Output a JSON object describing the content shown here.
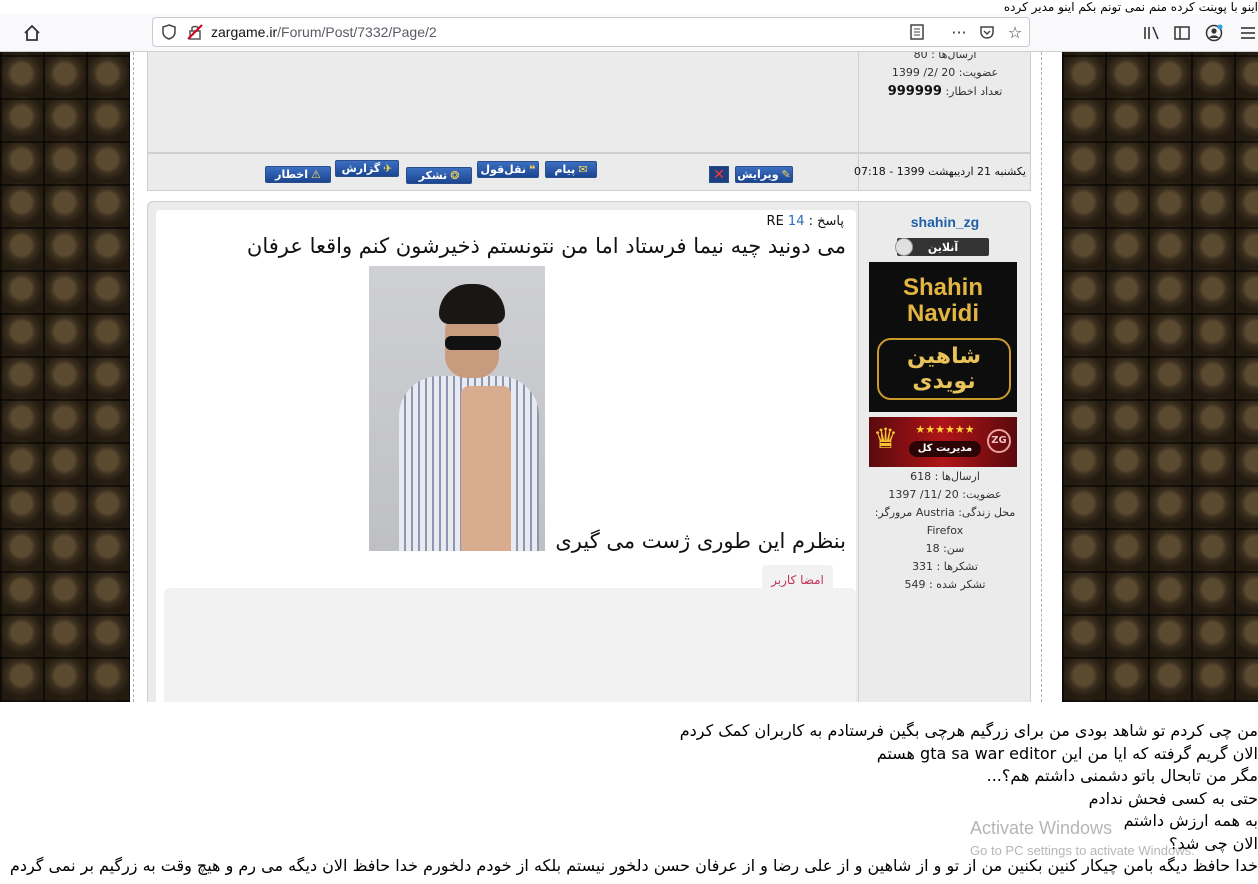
{
  "top_caption": "اینو با پوینت کرده منم نمی تونم بکم اینو مدیر کرده",
  "browser": {
    "url_domain": "zargame.ir",
    "url_path": "/Forum/Post/7332/Page/2",
    "icons": [
      "home-icon",
      "shield-icon",
      "insecure-lock-icon",
      "reader-view-icon",
      "more-icon",
      "pocket-icon",
      "bookmark-star-icon",
      "library-icon",
      "sidebar-icon",
      "account-icon",
      "menu-icon"
    ]
  },
  "prev_user": {
    "posts": "ارسال‌ها : 80",
    "joined": "عضویت: 20 /2/ 1399",
    "warnings_label": "تعداد اخطار:",
    "warnings_value": "999999"
  },
  "post_header": {
    "date": "یکشنبه 21 اردیبهشت 1399 - 07:18",
    "buttons": {
      "edit": "ویرایش",
      "message": "پیام",
      "quote": "نقل‌قول",
      "report": "گزارش",
      "thanks": "تشکر",
      "warn": "اخطار"
    }
  },
  "post": {
    "reply_label": "پاسخ :",
    "reply_number": "14",
    "reply_prefix": "RE",
    "line1": "می دونید چیه نیما فرستاد اما من نتونستم ذخیرشون کنم واقعا عرفان",
    "line2": "بنظرم این طوری ژست می گیری",
    "signature_tab": "امضا کاربر"
  },
  "user": {
    "username": "shahin_zg",
    "status": "آنلاین",
    "avatar_line1": "Shahin",
    "avatar_line2": "Navidi",
    "avatar_fa": "شاهین نویدی",
    "rank_stars": "★★★★★★",
    "rank_title": "مدیریت کل",
    "rank_logo": "ZG",
    "stats": [
      "ارسال‌ها : 618",
      "عضویت: 20 /11/ 1397",
      "محل زندگی: Austria مرورگر:",
      "Firefox",
      "سن: 18",
      "تشکرها : 331",
      "تشکر شده : 549"
    ]
  },
  "bottom_lines": [
    "من چی کردم تو شاهد بودی من برای زرگیم هرچی بگین فرستادم به کاربران کمک کردم",
    "الان گریم گرفته که ایا من این gta sa war editor هستم",
    "مگر من تابحال باتو دشمنی داشتم هم؟...",
    "حتی به کسی فحش ندادم",
    "به همه ارزش داشتم",
    "الان چی شد؟",
    "خدا حافظ دیگه بامن چیکار کنین بکنین من از تو و از شاهین و از علی رضا و از عرفان حسن دلخور نیستم بلکه از خودم دلخورم خدا حافظ الان دیگه می رم و هیچ وقت به زرگیم بر نمی گردم"
  ],
  "watermark": {
    "title": "Activate Windows",
    "subtitle": "Go to PC settings to activate Windows."
  }
}
